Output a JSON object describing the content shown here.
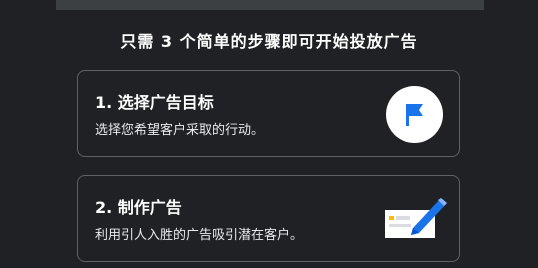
{
  "header": {
    "title": "只需 3 个简单的步骤即可开始投放广告"
  },
  "steps": [
    {
      "title": "1. 选择广告目标",
      "description": "选择您希望客户采取的行动。",
      "icon": "flag-icon"
    },
    {
      "title": "2. 制作广告",
      "description": "利用引人入胜的广告吸引潜在客户。",
      "icon": "pencil-ad-icon"
    }
  ],
  "colors": {
    "background": "#202124",
    "card_border": "#5f6368",
    "accent_blue": "#1a73e8",
    "accent_yellow": "#fbbc04"
  }
}
